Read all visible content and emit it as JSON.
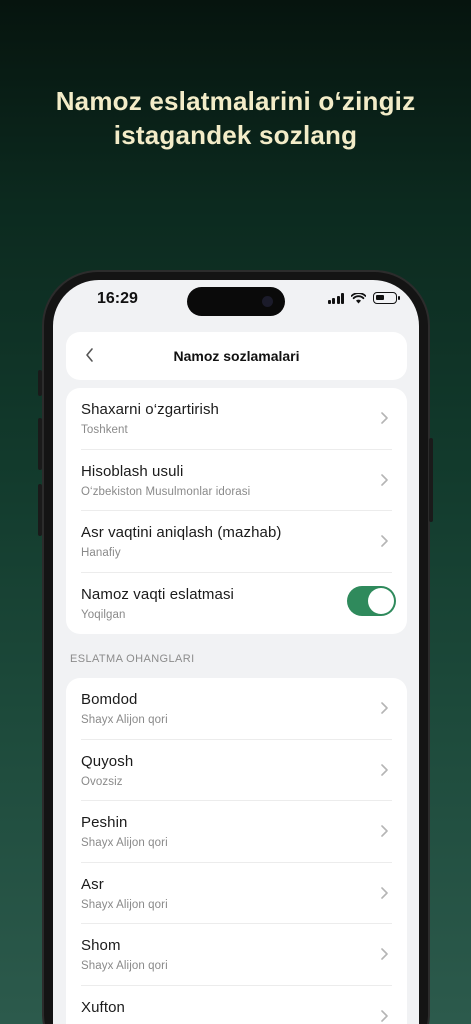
{
  "promo": {
    "line1": "Namoz eslatmalarini o‘zingiz",
    "line2": "istagandek sozlang"
  },
  "status_bar": {
    "time": "16:29",
    "icons": [
      "signal-icon",
      "wifi-icon",
      "battery-icon"
    ]
  },
  "header": {
    "back_icon": "chevron-left-icon",
    "title": "Namoz sozlamalari"
  },
  "settings": [
    {
      "label": "Shaxarni o‘zgartirish",
      "value": "Toshkent"
    },
    {
      "label": "Hisoblash usuli",
      "value": "O‘zbekiston Musulmonlar idorasi"
    },
    {
      "label": "Asr vaqtini aniqlash (mazhab)",
      "value": "Hanafiy"
    },
    {
      "label": "Namoz vaqti eslatmasi",
      "value": "Yoqilgan",
      "toggle_on": true
    }
  ],
  "sounds_section": {
    "title": "ESLATMA OHANGLARI",
    "items": [
      {
        "label": "Bomdod",
        "value": "Shayx Alijon qori"
      },
      {
        "label": "Quyosh",
        "value": "Ovozsiz"
      },
      {
        "label": "Peshin",
        "value": "Shayx Alijon qori"
      },
      {
        "label": "Asr",
        "value": "Shayx Alijon qori"
      },
      {
        "label": "Shom",
        "value": "Shayx Alijon qori"
      },
      {
        "label": "Xufton",
        "value": ""
      }
    ]
  },
  "colors": {
    "accent": "#2f8a5c",
    "promo_text": "#f3ecc8",
    "screen_bg": "#f1f2f4"
  }
}
